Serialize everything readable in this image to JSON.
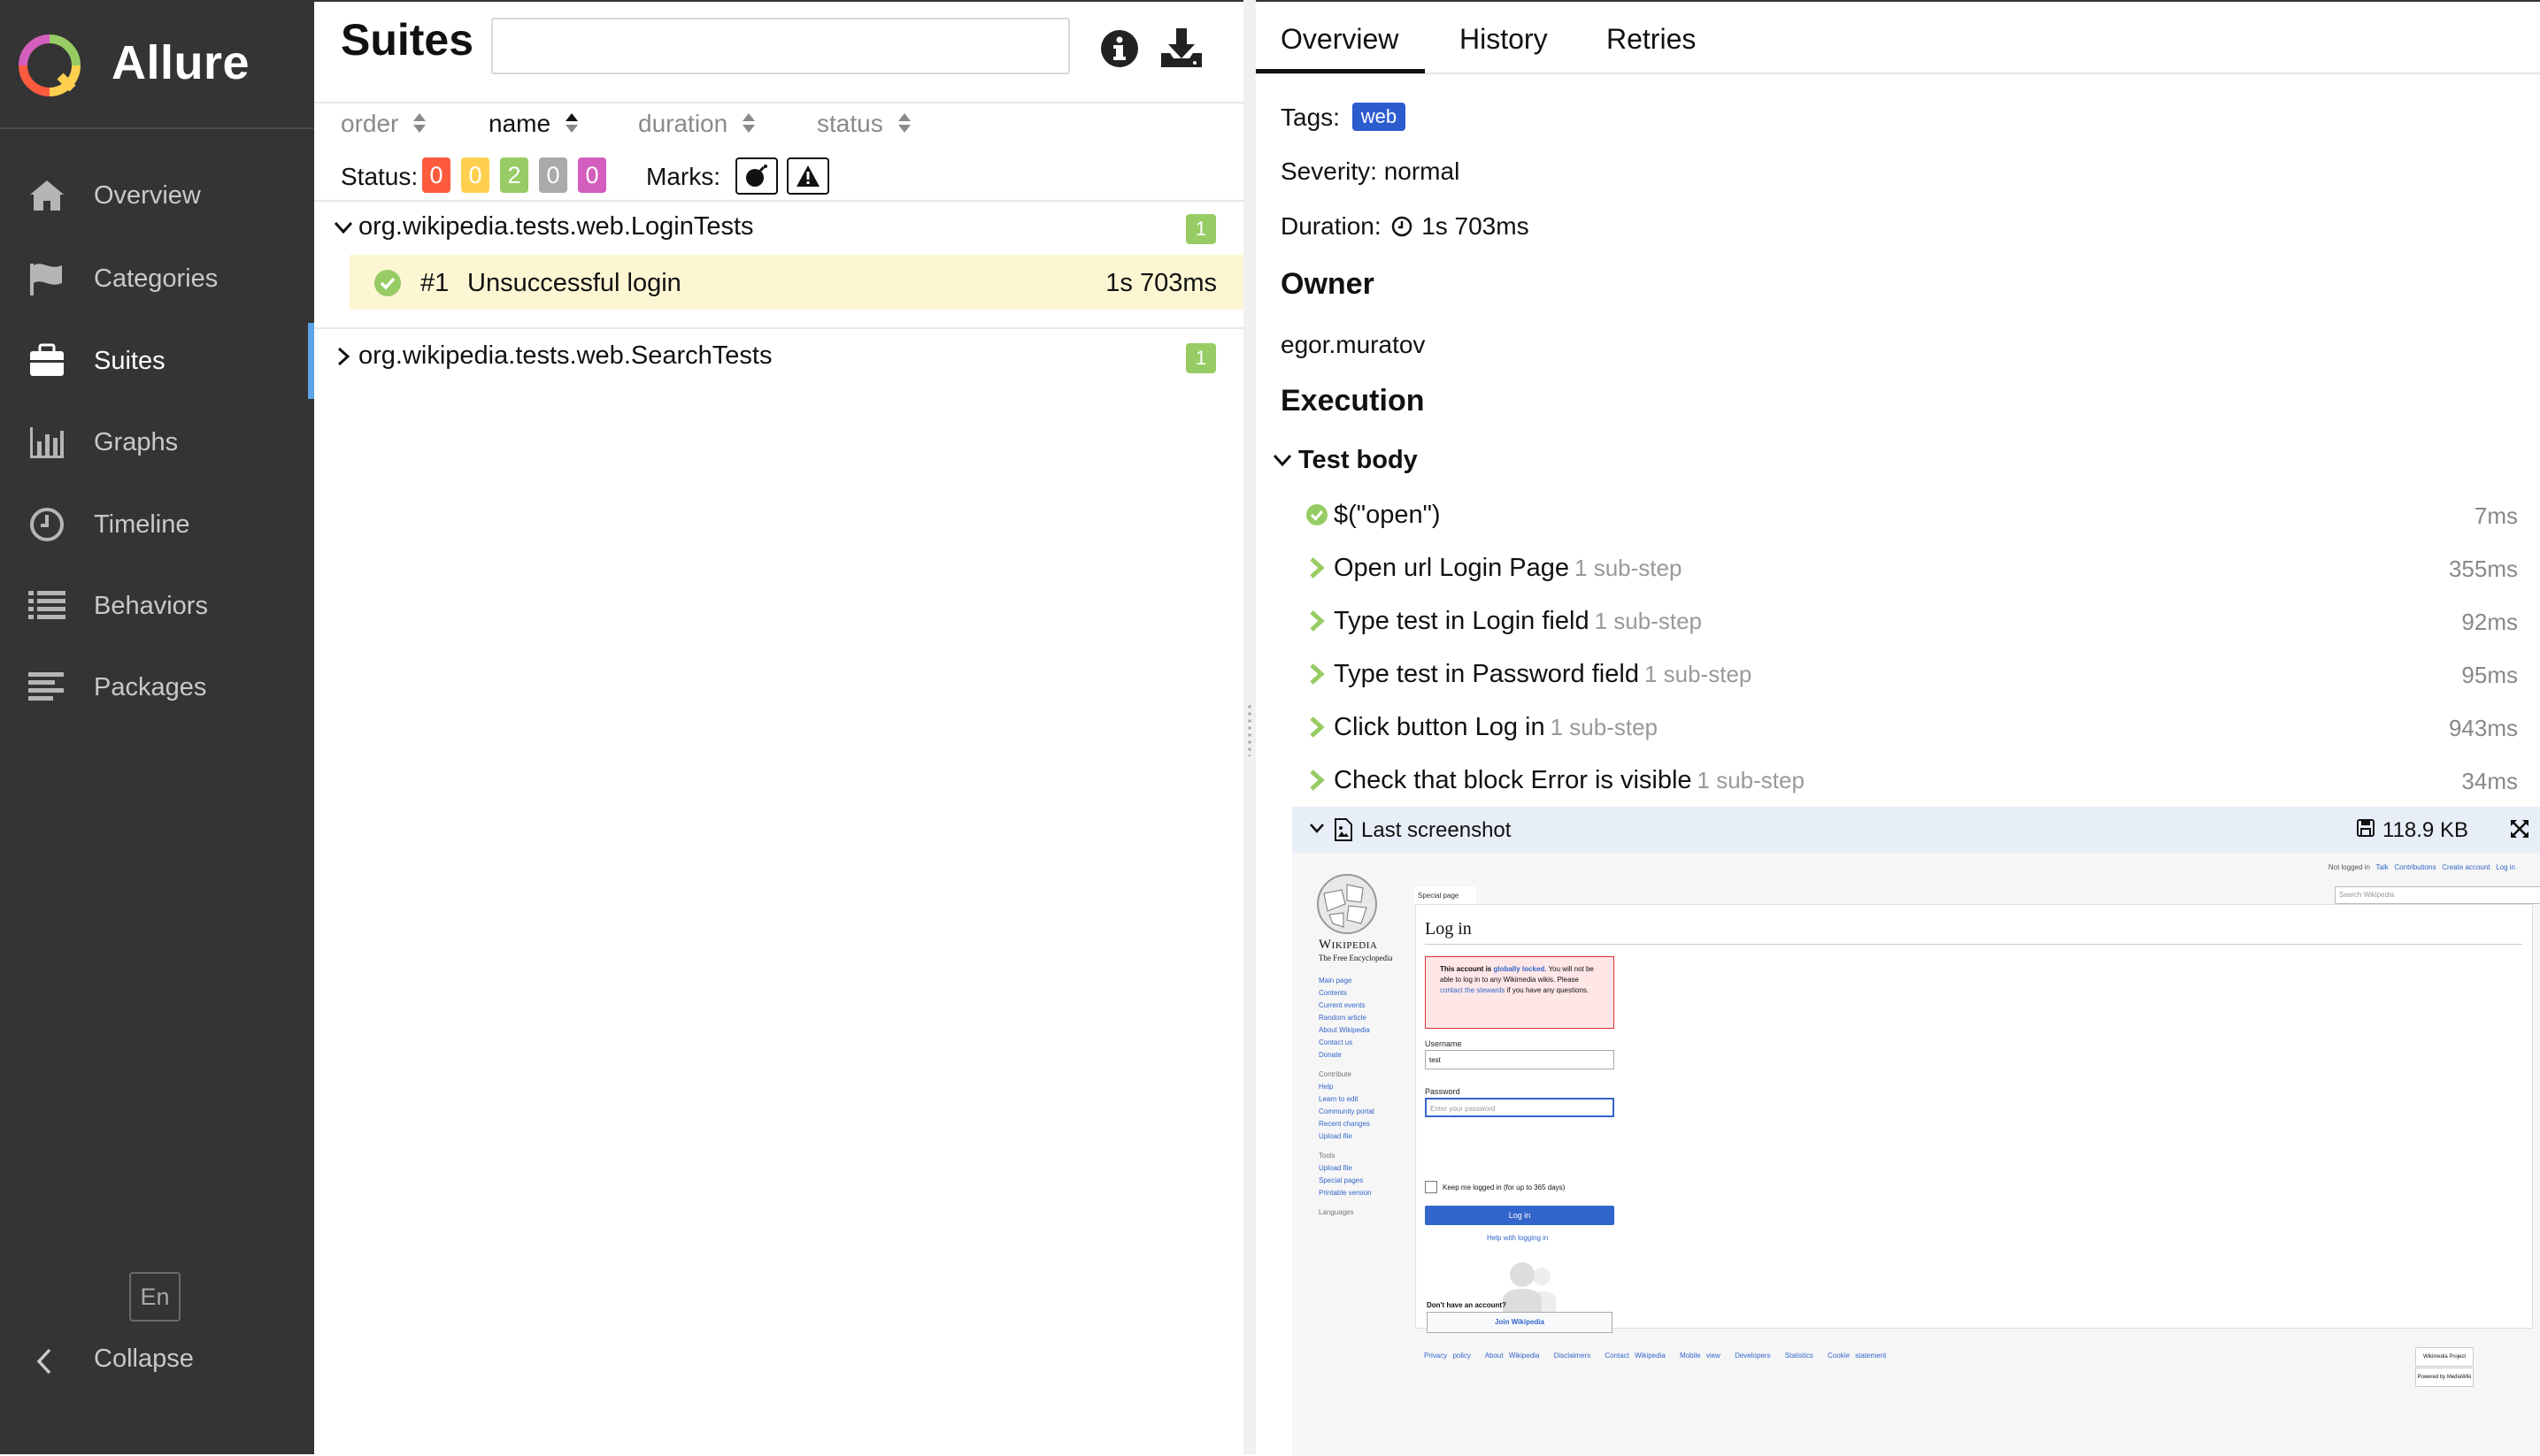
{
  "app": {
    "name": "Allure"
  },
  "sidebar": {
    "items": [
      {
        "label": "Overview",
        "icon": "home-icon"
      },
      {
        "label": "Categories",
        "icon": "flag-icon"
      },
      {
        "label": "Suites",
        "icon": "briefcase-icon",
        "active": true
      },
      {
        "label": "Graphs",
        "icon": "bar-chart-icon"
      },
      {
        "label": "Timeline",
        "icon": "clock-icon"
      },
      {
        "label": "Behaviors",
        "icon": "list-icon"
      },
      {
        "label": "Packages",
        "icon": "align-left-icon"
      }
    ],
    "language": "En",
    "collapse_label": "Collapse"
  },
  "suites_pane": {
    "title": "Suites",
    "search": {
      "value": "",
      "placeholder": ""
    },
    "sort": [
      {
        "label": "order"
      },
      {
        "label": "name",
        "active": true
      },
      {
        "label": "duration"
      },
      {
        "label": "status"
      }
    ],
    "status_label": "Status:",
    "status_counts": [
      {
        "value": "0",
        "color": "#fd5a3e"
      },
      {
        "value": "0",
        "color": "#ffd050"
      },
      {
        "value": "2",
        "color": "#97cc64"
      },
      {
        "value": "0",
        "color": "#aaaaaa"
      },
      {
        "value": "0",
        "color": "#d35ebe"
      }
    ],
    "marks_label": "Marks:",
    "marks": [
      {
        "icon": "bomb-icon"
      },
      {
        "icon": "warning-icon"
      }
    ],
    "suites": [
      {
        "name": "org.wikipedia.tests.web.LoginTests",
        "count": "1",
        "expanded": true,
        "tests": [
          {
            "num": "#1",
            "name": "Unsuccessful login",
            "duration": "1s 703ms",
            "status": "passed"
          }
        ]
      },
      {
        "name": "org.wikipedia.tests.web.SearchTests",
        "count": "1",
        "expanded": false
      }
    ]
  },
  "detail": {
    "tabs": [
      {
        "label": "Overview",
        "active": true
      },
      {
        "label": "History"
      },
      {
        "label": "Retries"
      }
    ],
    "tags_label": "Tags:",
    "tag": "web",
    "severity": "Severity: normal",
    "duration_label": "Duration:",
    "duration": "1s 703ms",
    "owner_heading": "Owner",
    "owner": "egor.muratov",
    "execution_heading": "Execution",
    "test_body_label": "Test body",
    "steps": [
      {
        "name": "$(\"open\")",
        "sub": "",
        "duration": "7ms",
        "icon": "check-circle-icon"
      },
      {
        "name": "Open url Login Page",
        "sub": "1 sub-step",
        "duration": "355ms",
        "icon": "chevron-right-icon"
      },
      {
        "name": "Type test in Login field",
        "sub": "1 sub-step",
        "duration": "92ms",
        "icon": "chevron-right-icon"
      },
      {
        "name": "Type test in Password field",
        "sub": "1 sub-step",
        "duration": "95ms",
        "icon": "chevron-right-icon"
      },
      {
        "name": "Click button Log in",
        "sub": "1 sub-step",
        "duration": "943ms",
        "icon": "chevron-right-icon"
      },
      {
        "name": "Check that block Error is visible",
        "sub": "1 sub-step",
        "duration": "34ms",
        "icon": "chevron-right-icon"
      }
    ],
    "attachment": {
      "name": "Last screenshot",
      "size": "118.9 KB"
    }
  },
  "screenshot": {
    "wordmark": "Wikipedia",
    "tagline": "The Free Encyclopedia",
    "top_links": [
      "Not logged in",
      "Talk",
      "Contributions",
      "Create account",
      "Log in"
    ],
    "search_placeholder": "Search Wikipedia",
    "special_tab": "Special page",
    "heading": "Log in",
    "sidebar_main": [
      "Main page",
      "Contents",
      "Current events",
      "Random article",
      "About Wikipedia",
      "Contact us",
      "Donate"
    ],
    "sidebar_contribute_heading": "Contribute",
    "sidebar_contribute": [
      "Help",
      "Learn to edit",
      "Community portal",
      "Recent changes",
      "Upload file"
    ],
    "sidebar_tools_heading": "Tools",
    "sidebar_tools": [
      "Upload file",
      "Special pages",
      "Printable version"
    ],
    "sidebar_languages": "Languages",
    "error_prefix": "This account is",
    "error_link": "globally locked.",
    "error_text": "You will not be able to log in to any Wikimedia wikis. Please",
    "error_link2": "contact the stewards",
    "error_suffix": "if you have any questions.",
    "username_label": "Username",
    "username_value": "test",
    "password_label": "Password",
    "password_placeholder": "Enter your password",
    "keep_logged": "Keep me logged in (for up to 365 days)",
    "login_button": "Log in",
    "help_link": "Help with logging in",
    "no_account": "Don't have an account?",
    "join_button": "Join Wikipedia",
    "footer_links": [
      "Privacy policy",
      "About Wikipedia",
      "Disclaimers",
      "Contact Wikipedia",
      "Mobile view",
      "Developers",
      "Statistics",
      "Cookie statement"
    ],
    "badges": [
      "Wikimedia Project",
      "Powered by MediaWiki"
    ]
  }
}
